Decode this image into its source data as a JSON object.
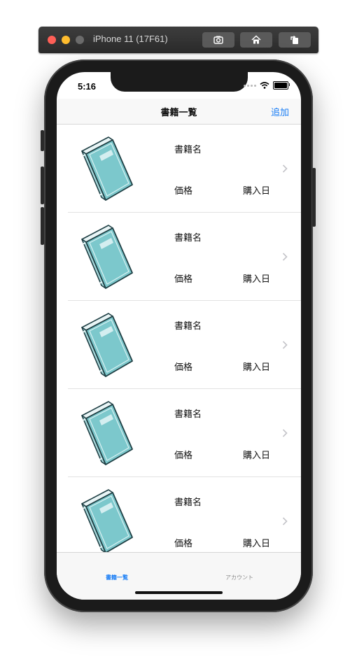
{
  "simulator": {
    "title": "iPhone 11 (17F61)",
    "buttons": [
      "screenshot-icon",
      "home-icon",
      "rotate-icon"
    ]
  },
  "status_bar": {
    "time": "5:16"
  },
  "nav": {
    "title": "書籍一覧",
    "add_label": "追加"
  },
  "books": [
    {
      "title": "書籍名",
      "price": "価格",
      "date": "購入日"
    },
    {
      "title": "書籍名",
      "price": "価格",
      "date": "購入日"
    },
    {
      "title": "書籍名",
      "price": "価格",
      "date": "購入日"
    },
    {
      "title": "書籍名",
      "price": "価格",
      "date": "購入日"
    },
    {
      "title": "書籍名",
      "price": "価格",
      "date": "購入日"
    }
  ],
  "tabs": [
    {
      "label": "書籍一覧",
      "active": true
    },
    {
      "label": "アカウント",
      "active": false
    }
  ],
  "colors": {
    "accent": "#1a7ef5",
    "book_cover": "#7cc8cc"
  }
}
